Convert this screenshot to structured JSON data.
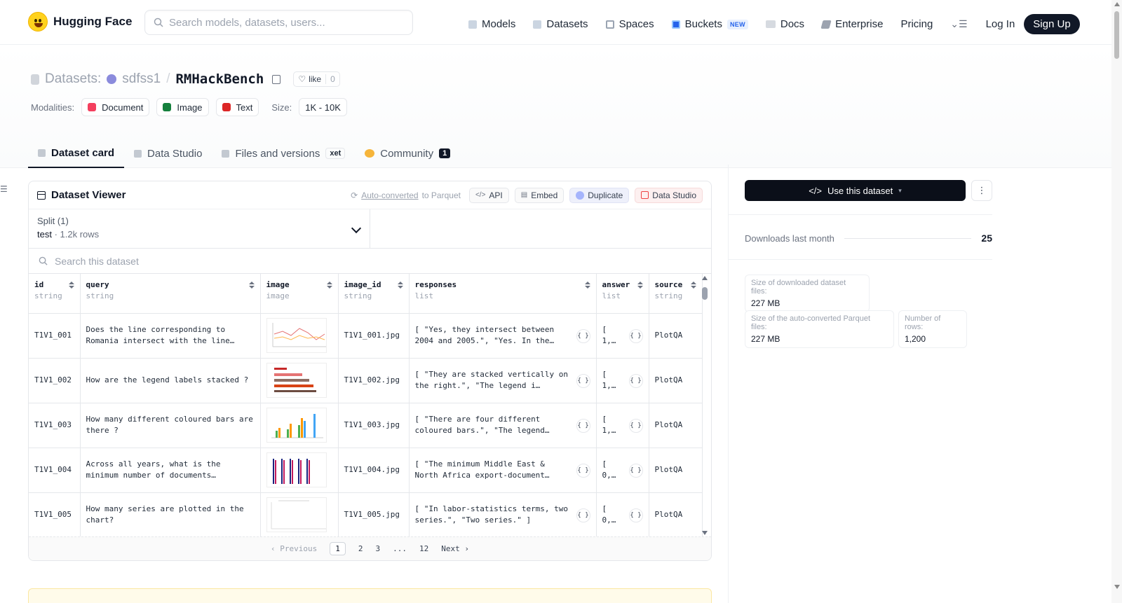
{
  "header": {
    "brand": "Hugging Face",
    "search_placeholder": "Search models, datasets, users...",
    "nav": [
      {
        "label": "Models",
        "icon": "models-icon"
      },
      {
        "label": "Datasets",
        "icon": "datasets-icon"
      },
      {
        "label": "Spaces",
        "icon": "spaces-icon"
      },
      {
        "label": "Buckets",
        "icon": "buckets-icon",
        "badge": "NEW"
      },
      {
        "label": "Docs",
        "icon": "docs-icon"
      },
      {
        "label": "Enterprise",
        "icon": "enterprise-icon"
      },
      {
        "label": "Pricing"
      }
    ],
    "login": "Log In",
    "signup": "Sign Up"
  },
  "dataset": {
    "section": "Datasets:",
    "org": "sdfss1",
    "name": "RMHackBench",
    "like_label": "like",
    "like_count": "0",
    "modalities_label": "Modalities:",
    "modalities": [
      {
        "label": "Document",
        "color": "#f43f5e"
      },
      {
        "label": "Image",
        "color": "#15803d"
      },
      {
        "label": "Text",
        "color": "#dc2626"
      }
    ],
    "size_label": "Size:",
    "size": "1K - 10K"
  },
  "tabs": [
    {
      "label": "Dataset card",
      "active": true
    },
    {
      "label": "Data Studio"
    },
    {
      "label": "Files and versions",
      "badge": "xet"
    },
    {
      "label": "Community",
      "badge": "1"
    }
  ],
  "viewer": {
    "title": "Dataset Viewer",
    "auto_link": "Auto-converted",
    "auto_rest": "to Parquet",
    "api": "API",
    "embed": "Embed",
    "duplicate": "Duplicate",
    "data_studio": "Data Studio",
    "split_label": "Split (1)",
    "split_value": "test",
    "split_rows": "1.2k rows",
    "search_placeholder": "Search this dataset",
    "columns": [
      {
        "name": "id",
        "type": "string"
      },
      {
        "name": "query",
        "type": "string"
      },
      {
        "name": "image",
        "type": "image"
      },
      {
        "name": "image_id",
        "type": "string"
      },
      {
        "name": "responses",
        "type": "list"
      },
      {
        "name": "answer",
        "type": "list"
      },
      {
        "name": "source",
        "type": "string"
      }
    ],
    "rows": [
      {
        "id": "T1V1_001",
        "query": "Does the line corresponding to Romania intersect with the line…",
        "image_id": "T1V1_001.jpg",
        "responses": "[ \"Yes, they intersect between 2004 and 2005.\", \"Yes. In the…",
        "answer": "[ 1,…",
        "source": "PlotQA"
      },
      {
        "id": "T1V1_002",
        "query": "How are the legend labels stacked ?",
        "image_id": "T1V1_002.jpg",
        "responses": "[ \"They are stacked vertically on the right.\", \"The legend i…",
        "answer": "[ 1,…",
        "source": "PlotQA"
      },
      {
        "id": "T1V1_003",
        "query": "How many different coloured bars are there ?",
        "image_id": "T1V1_003.jpg",
        "responses": "[ \"There are four different coloured bars.\", \"The legend…",
        "answer": "[ 1,…",
        "source": "PlotQA"
      },
      {
        "id": "T1V1_004",
        "query": "Across all years, what is the minimum number of documents…",
        "image_id": "T1V1_004.jpg",
        "responses": "[ \"The minimum Middle East & North Africa export-document…",
        "answer": "[ 0,…",
        "source": "PlotQA"
      },
      {
        "id": "T1V1_005",
        "query": "How many series are plotted in the chart?",
        "image_id": "T1V1_005.jpg",
        "responses": "[ \"In labor-statistics terms, two series.\", \"Two series.\" ]",
        "answer": "[ 0,…",
        "source": "PlotQA"
      }
    ],
    "pager": {
      "prev": "Previous",
      "pages": [
        "1",
        "2",
        "3",
        "...",
        "12"
      ],
      "next": "Next"
    }
  },
  "sidebar": {
    "use_button": "Use this dataset",
    "downloads_label": "Downloads last month",
    "downloads_value": "25",
    "stats": [
      {
        "label": "Size of downloaded dataset files:",
        "value": "227 MB"
      },
      {
        "label": "Size of the auto-converted Parquet files:",
        "value": "227 MB"
      },
      {
        "label": "Number of rows:",
        "value": "1,200"
      }
    ]
  }
}
